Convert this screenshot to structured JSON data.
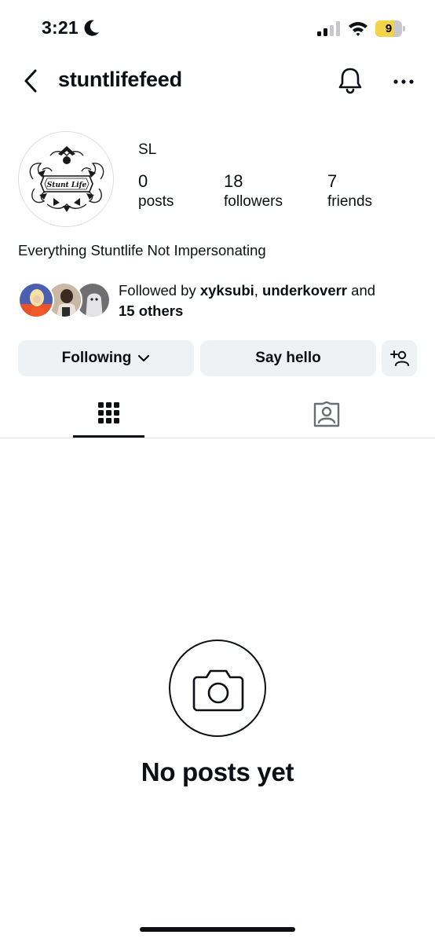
{
  "status_bar": {
    "time": "3:21",
    "battery_level": "9",
    "battery_fraction": 0.09
  },
  "header": {
    "username": "stuntlifefeed"
  },
  "profile": {
    "display_name": "SL",
    "avatar_logo_text": "Stunt Life",
    "stats": [
      {
        "count": "0",
        "label": "posts"
      },
      {
        "count": "18",
        "label": "followers"
      },
      {
        "count": "7",
        "label": "friends"
      }
    ],
    "bio": "Everything Stuntlife Not Impersonating",
    "followed_by": {
      "prefix": "Followed by ",
      "user1": "xyksubi",
      "separator": ", ",
      "user2": "underkoverr",
      "conjunction": " and",
      "others": "15 others"
    }
  },
  "actions": {
    "following_label": "Following",
    "say_hello_label": "Say hello"
  },
  "tabs": {
    "active": "grid"
  },
  "empty_state": {
    "title": "No posts yet"
  },
  "colors": {
    "text": "#0c1014",
    "button_bg": "#eff2f5",
    "battery_fill": "#f3d34a"
  }
}
